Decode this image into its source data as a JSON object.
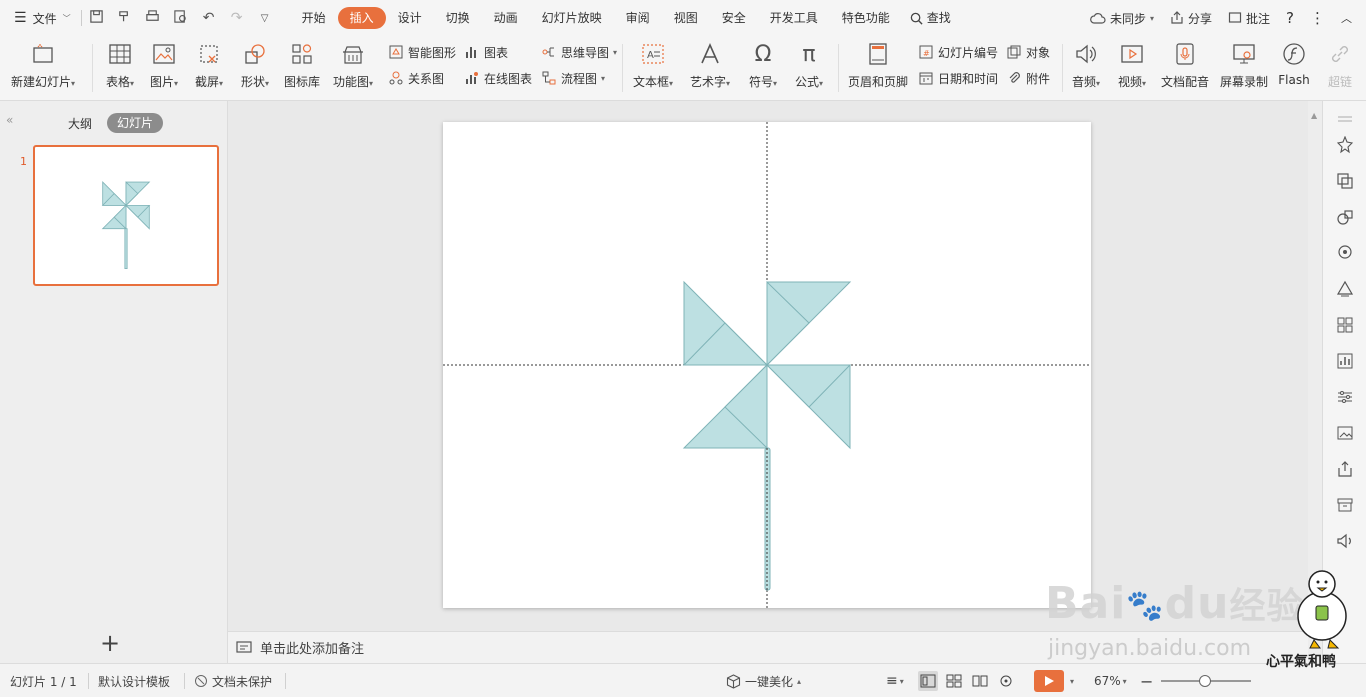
{
  "menubar": {
    "file_label": "文件",
    "tabs": [
      "开始",
      "插入",
      "设计",
      "切换",
      "动画",
      "幻灯片放映",
      "审阅",
      "视图",
      "安全",
      "开发工具",
      "特色功能"
    ],
    "active_tab": "插入",
    "search_label": "查找",
    "sync_label": "未同步",
    "share_label": "分享",
    "comment_label": "批注"
  },
  "ribbon": {
    "new_slide": "新建幻灯片",
    "table": "表格",
    "picture": "图片",
    "screenshot": "截屏",
    "shape": "形状",
    "icon_lib": "图标库",
    "function_chart": "功能图",
    "smart_shape": "智能图形",
    "chart": "图表",
    "relation_chart": "关系图",
    "online_chart": "在线图表",
    "mind_map": "思维导图",
    "flowchart": "流程图",
    "textbox": "文本框",
    "wordart": "艺术字",
    "symbol": "符号",
    "formula": "公式",
    "header_footer": "页眉和页脚",
    "slide_number": "幻灯片编号",
    "object": "对象",
    "date_time": "日期和时间",
    "attachment": "附件",
    "audio": "音频",
    "video": "视频",
    "doc_dub": "文档配音",
    "screen_record": "屏幕录制",
    "flash": "Flash",
    "hyperlink": "超链"
  },
  "leftpanel": {
    "outline_tab": "大纲",
    "slides_tab": "幻灯片",
    "slide_number": "1",
    "add_symbol": "+"
  },
  "notes": {
    "placeholder": "单击此处添加备注"
  },
  "statusbar": {
    "slide_info": "幻灯片 1 / 1",
    "template": "默认设计模板",
    "protection": "文档未保护",
    "beautify": "一键美化",
    "zoom": "67%"
  },
  "watermark": {
    "logo_text": "Bai",
    "logo_text_2": "du",
    "logo_cn": "经验",
    "url": "jingyan.baidu.com",
    "signature": "心平氣和鸭"
  },
  "colors": {
    "accent": "#e8703d",
    "pinwheel_fill": "#bde0e2",
    "pinwheel_stroke": "#7fb3b7"
  }
}
